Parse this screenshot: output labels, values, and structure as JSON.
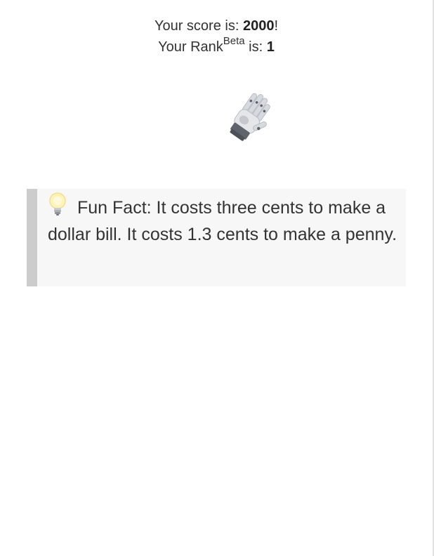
{
  "score": {
    "prefix": "Your score is: ",
    "value": "2000",
    "suffix": "!"
  },
  "rank": {
    "prefix": "Your Rank",
    "superscript": "Beta",
    "middle": " is: ",
    "value": "1"
  },
  "image": {
    "icon": "robot-hand-icon"
  },
  "fun_fact": {
    "icon": "light-bulb-icon",
    "text": "Fun Fact: It costs three cents to make a dollar bill. It costs 1.3 cents to make a penny."
  },
  "colors": {
    "fact_background": "#f7f7f7",
    "fact_border": "#cccccc",
    "text": "#333333"
  }
}
